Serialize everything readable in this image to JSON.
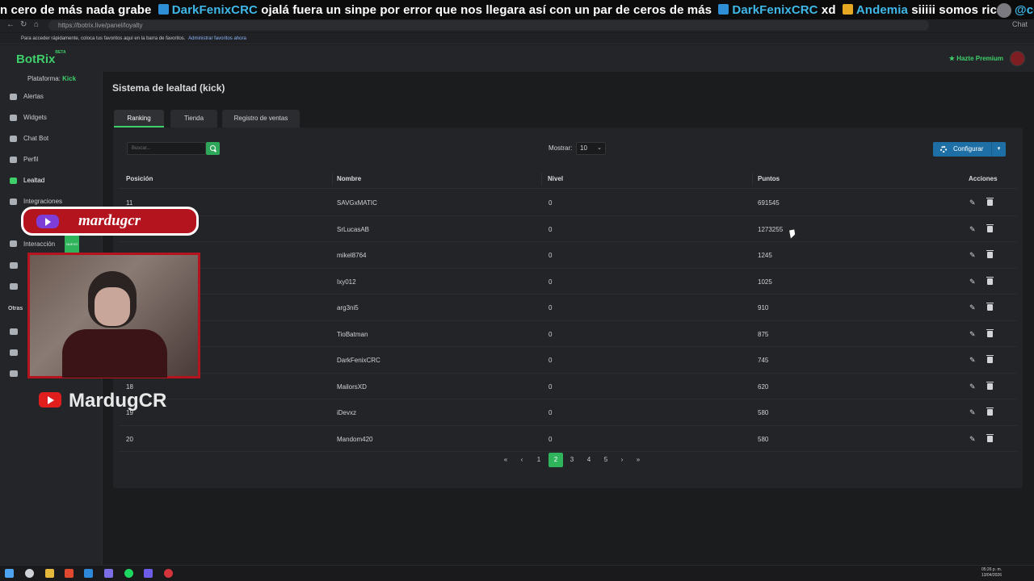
{
  "ticker": {
    "part1": "n cero de más nada grabe ",
    "user1": "DarkFenixCRC",
    "part2": " ojalá fuera un sinpe por error que nos llegara así con un par de ceros de más ",
    "user2": "DarkFenixCRC",
    "part3": " xd ",
    "user3": "Andemia",
    "part4": " siiiii somos ricos ",
    "mention": "@cookie_NM"
  },
  "browser": {
    "url": "https://botrix.live/panel/loyalty",
    "bookmarks_text": "Para acceder rápidamente, coloca tus favoritos aquí en la barra de favoritos.",
    "bookmarks_link": "Administrar favoritos ahora",
    "chat_label": "Chat"
  },
  "app": {
    "logo": "BotRix",
    "logo_badge": "BETA",
    "premium_label": "Hazte Premium"
  },
  "sidebar": {
    "platform_label": "Plataforma:",
    "platform_value": "Kick",
    "items": [
      {
        "label": "Alertas",
        "icon": "warning-icon"
      },
      {
        "label": "Widgets",
        "icon": "grid-icon"
      },
      {
        "label": "Chat Bot",
        "icon": "robot-icon"
      },
      {
        "label": "Perfil",
        "icon": "user-icon"
      },
      {
        "label": "Lealtad",
        "icon": "trophy-icon"
      },
      {
        "label": "Integraciones",
        "icon": "plug-icon"
      },
      {
        "label": "Interacción",
        "icon": "music-icon"
      }
    ],
    "nuevo_badge": "NUEVO",
    "otras_label": "Otras"
  },
  "page": {
    "title": "Sistema de lealtad (kick)",
    "tabs": [
      "Ranking",
      "Tienda",
      "Registro de ventas"
    ],
    "search_placeholder": "Buscar...",
    "show_label": "Mostrar:",
    "show_value": "10",
    "config_label": "Configurar"
  },
  "table": {
    "headers": [
      "Posición",
      "Nombre",
      "Nivel",
      "Puntos",
      "Acciones"
    ],
    "rows": [
      {
        "pos": "11",
        "name": "SAVGxMATIC",
        "level": "0",
        "points": "691545"
      },
      {
        "pos": "",
        "name": "SrLucasAB",
        "level": "0",
        "points": "1273255"
      },
      {
        "pos": "",
        "name": "mikel8764",
        "level": "0",
        "points": "1245"
      },
      {
        "pos": "",
        "name": "Ixy012",
        "level": "0",
        "points": "1025"
      },
      {
        "pos": "",
        "name": "arg3ni5",
        "level": "0",
        "points": "910"
      },
      {
        "pos": "",
        "name": "TioBatman",
        "level": "0",
        "points": "875"
      },
      {
        "pos": "",
        "name": "DarkFenixCRC",
        "level": "0",
        "points": "745"
      },
      {
        "pos": "18",
        "name": "MailorsXD",
        "level": "0",
        "points": "620"
      },
      {
        "pos": "19",
        "name": "iDevxz",
        "level": "0",
        "points": "580"
      },
      {
        "pos": "20",
        "name": "Mandom420",
        "level": "0",
        "points": "580"
      }
    ]
  },
  "pagination": {
    "first": "«",
    "prev": "‹",
    "pages": [
      "1",
      "2",
      "3",
      "4",
      "5"
    ],
    "current": "2",
    "next": "›",
    "last": "»"
  },
  "overlay": {
    "twitch_name": "mardugcr",
    "youtube_name": "MardugCR"
  },
  "taskbar": {
    "time": "05:26 p. m.",
    "date": "13/04/2026"
  }
}
